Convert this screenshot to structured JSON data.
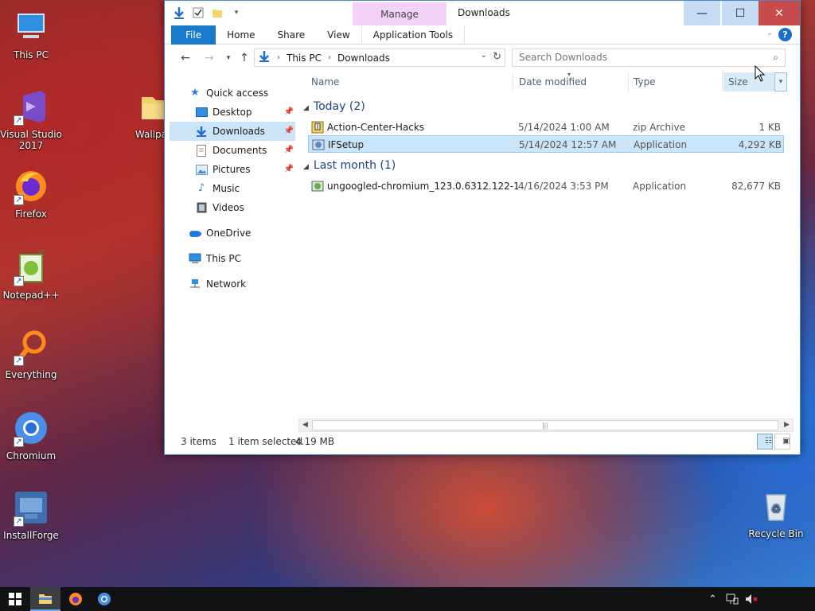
{
  "desktop": {
    "icons": [
      {
        "label": "This PC"
      },
      {
        "label": "Visual Studio 2017"
      },
      {
        "label": "Firefox"
      },
      {
        "label": "Notepad++"
      },
      {
        "label": "Everything"
      },
      {
        "label": "Chromium"
      },
      {
        "label": "InstallForge"
      },
      {
        "label": "Wallpa"
      },
      {
        "label": "Recycle Bin"
      }
    ]
  },
  "window": {
    "manage_tab": "Manage",
    "title": "Downloads",
    "controls": {
      "minimize": "—",
      "maximize": "☐",
      "close": "✕"
    }
  },
  "ribbon": {
    "tabs": [
      {
        "label": "File"
      },
      {
        "label": "Home"
      },
      {
        "label": "Share"
      },
      {
        "label": "View"
      },
      {
        "label": "Application Tools"
      }
    ],
    "help": "?"
  },
  "address": {
    "crumbs": [
      "This PC",
      "Downloads"
    ],
    "search_placeholder": "Search Downloads"
  },
  "navpane": {
    "quick_access": "Quick access",
    "items": [
      {
        "label": "Desktop"
      },
      {
        "label": "Downloads"
      },
      {
        "label": "Documents"
      },
      {
        "label": "Pictures"
      },
      {
        "label": "Music"
      },
      {
        "label": "Videos"
      }
    ],
    "onedrive": "OneDrive",
    "this_pc": "This PC",
    "network": "Network"
  },
  "columns": {
    "name": "Name",
    "date": "Date modified",
    "type": "Type",
    "size": "Size"
  },
  "groups": [
    {
      "label": "Today (2)",
      "files": [
        {
          "name": "Action-Center-Hacks",
          "date": "5/14/2024 1:00 AM",
          "type": "zip Archive",
          "size": "1 KB"
        },
        {
          "name": "IFSetup",
          "date": "5/14/2024 12:57 AM",
          "type": "Application",
          "size": "4,292 KB"
        }
      ]
    },
    {
      "label": "Last month (1)",
      "files": [
        {
          "name": "ungoogled-chromium_123.0.6312.122-1....",
          "date": "4/16/2024 3:53 PM",
          "type": "Application",
          "size": "82,677 KB"
        }
      ]
    }
  ],
  "status": {
    "items": "3 items",
    "selected": "1 item selected",
    "size": "4.19 MB"
  }
}
